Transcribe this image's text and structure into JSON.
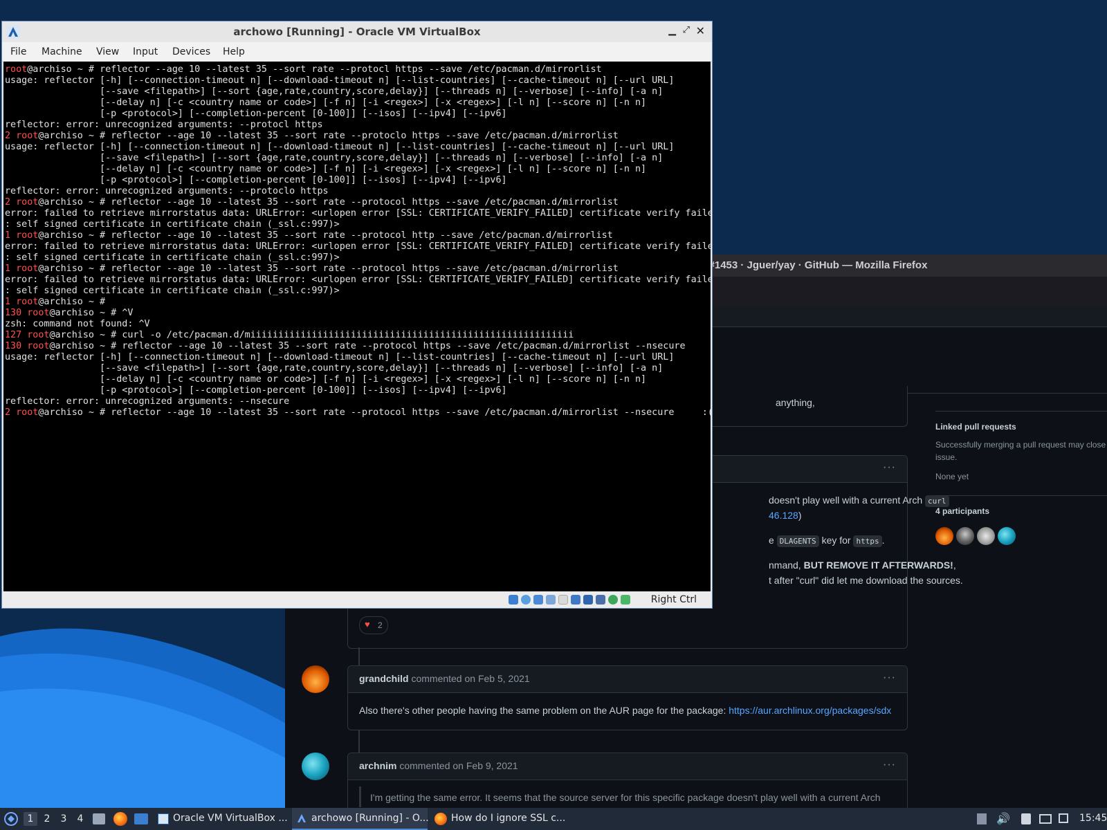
{
  "firefox": {
    "title": "e #1453 · Jguer/yay · GitHub — Mozilla Firefox",
    "comment1": {
      "partial_top": "anything,",
      "line1": "doesn't play well with a current Arch",
      "line1_code": "curl",
      "line2_link": "46.128",
      "line2_end": ")",
      "line3_pre": "e",
      "line3_code1": "DLAGENTS",
      "line3_mid": "key for",
      "line3_code2": "https",
      "line3_end": ".",
      "line4_pre": "nmand,",
      "line4_bold": "BUT REMOVE IT AFTERWARDS!",
      "line4_end": ",",
      "line5": "t after \"curl\" did let me download the sources.",
      "reaction_count": "2"
    },
    "comment2": {
      "author": "grandchild",
      "meta": "commented on Feb 5, 2021",
      "text": "Also there's other people having the same problem on the AUR page for the package:",
      "link": "https://aur.archlinux.org/packages/sdx"
    },
    "comment3": {
      "author": "archnim",
      "meta": "commented on Feb 9, 2021",
      "quote": "I'm getting the same error. It seems that the source server for this specific package doesn't play well with a current Arch"
    },
    "sidebar": {
      "linked_heading": "Linked pull requests",
      "linked_text1": "Successfully merging a pull request may close",
      "linked_text2": "issue.",
      "linked_none": "None yet",
      "participants_heading": "4 participants"
    },
    "more_label": "···"
  },
  "vbox": {
    "title": "archowo [Running] - Oracle VM VirtualBox",
    "menu": [
      "File",
      "Machine",
      "View",
      "Input",
      "Devices",
      "Help"
    ],
    "status_key": "Right Ctrl",
    "terminal_lines": [
      {
        "code": "",
        "prompt": "root@archiso ~ # ",
        "text": "reflector --age 10 --latest 35 --sort rate --protocl https --save /etc/pacman.d/mirrorlist"
      },
      {
        "code": "",
        "prompt": "",
        "text": "usage: reflector [-h] [--connection-timeout n] [--download-timeout n] [--list-countries] [--cache-timeout n] [--url URL]"
      },
      {
        "code": "",
        "prompt": "",
        "text": "                 [--save <filepath>] [--sort {age,rate,country,score,delay}] [--threads n] [--verbose] [--info] [-a n]"
      },
      {
        "code": "",
        "prompt": "",
        "text": "                 [--delay n] [-c <country name or code>] [-f n] [-i <regex>] [-x <regex>] [-l n] [--score n] [-n n]"
      },
      {
        "code": "",
        "prompt": "",
        "text": "                 [-p <protocol>] [--completion-percent [0-100]] [--isos] [--ipv4] [--ipv6]"
      },
      {
        "code": "",
        "prompt": "",
        "text": "reflector: error: unrecognized arguments: --protocl https"
      },
      {
        "code": "2 ",
        "prompt": "root@archiso ~ # ",
        "text": "reflector --age 10 --latest 35 --sort rate --protoclo https --save /etc/pacman.d/mirrorlist"
      },
      {
        "code": "",
        "prompt": "",
        "text": "usage: reflector [-h] [--connection-timeout n] [--download-timeout n] [--list-countries] [--cache-timeout n] [--url URL]"
      },
      {
        "code": "",
        "prompt": "",
        "text": "                 [--save <filepath>] [--sort {age,rate,country,score,delay}] [--threads n] [--verbose] [--info] [-a n]"
      },
      {
        "code": "",
        "prompt": "",
        "text": "                 [--delay n] [-c <country name or code>] [-f n] [-i <regex>] [-x <regex>] [-l n] [--score n] [-n n]"
      },
      {
        "code": "",
        "prompt": "",
        "text": "                 [-p <protocol>] [--completion-percent [0-100]] [--isos] [--ipv4] [--ipv6]"
      },
      {
        "code": "",
        "prompt": "",
        "text": "reflector: error: unrecognized arguments: --protoclo https"
      },
      {
        "code": "2 ",
        "prompt": "root@archiso ~ # ",
        "text": "reflector --age 10 --latest 35 --sort rate --protocol https --save /etc/pacman.d/mirrorlist"
      },
      {
        "code": "",
        "prompt": "",
        "text": "error: failed to retrieve mirrorstatus data: URLError: <urlopen error [SSL: CERTIFICATE_VERIFY_FAILED] certificate verify failed"
      },
      {
        "code": "",
        "prompt": "",
        "text": ": self signed certificate in certificate chain (_ssl.c:997)>"
      },
      {
        "code": "1 ",
        "prompt": "root@archiso ~ # ",
        "text": "reflector --age 10 --latest 35 --sort rate --protocol http --save /etc/pacman.d/mirrorlist"
      },
      {
        "code": "",
        "prompt": "",
        "text": "error: failed to retrieve mirrorstatus data: URLError: <urlopen error [SSL: CERTIFICATE_VERIFY_FAILED] certificate verify failed"
      },
      {
        "code": "",
        "prompt": "",
        "text": ": self signed certificate in certificate chain (_ssl.c:997)>"
      },
      {
        "code": "1 ",
        "prompt": "root@archiso ~ # ",
        "text": "reflector --age 10 --latest 35 --sort rate --protocol https --save /etc/pacman.d/mirrorlist"
      },
      {
        "code": "",
        "prompt": "",
        "text": "error: failed to retrieve mirrorstatus data: URLError: <urlopen error [SSL: CERTIFICATE_VERIFY_FAILED] certificate verify failed"
      },
      {
        "code": "",
        "prompt": "",
        "text": ": self signed certificate in certificate chain (_ssl.c:997)>"
      },
      {
        "code": "1 ",
        "prompt": "root@archiso ~ # ",
        "text": ""
      },
      {
        "code": "130 ",
        "prompt": "root@archiso ~ # ",
        "text": "^V"
      },
      {
        "code": "",
        "prompt": "",
        "text": "zsh: command not found: ^V"
      },
      {
        "code": "127 ",
        "prompt": "root@archiso ~ # ",
        "text": "curl -o /etc/pacman.d/miiiiiiiiiiiiiiiiiiiiiiiiiiiiiiiiiiiiiiiiiiiiiiiiiiiiiiiiii"
      },
      {
        "code": "130 ",
        "prompt": "root@archiso ~ # ",
        "text": "reflector --age 10 --latest 35 --sort rate --protocol https --save /etc/pacman.d/mirrorlist --nsecure"
      },
      {
        "code": "",
        "prompt": "",
        "text": "usage: reflector [-h] [--connection-timeout n] [--download-timeout n] [--list-countries] [--cache-timeout n] [--url URL]"
      },
      {
        "code": "",
        "prompt": "",
        "text": "                 [--save <filepath>] [--sort {age,rate,country,score,delay}] [--threads n] [--verbose] [--info] [-a n]"
      },
      {
        "code": "",
        "prompt": "",
        "text": "                 [--delay n] [-c <country name or code>] [-f n] [-i <regex>] [-x <regex>] [-l n] [--score n] [-n n]"
      },
      {
        "code": "",
        "prompt": "",
        "text": "                 [-p <protocol>] [--completion-percent [0-100]] [--isos] [--ipv4] [--ipv6]"
      },
      {
        "code": "",
        "prompt": "",
        "text": "reflector: error: unrecognized arguments: --nsecure"
      },
      {
        "code": "2 ",
        "prompt": "root@archiso ~ # ",
        "text": "reflector --age 10 --latest 35 --sort rate --protocol https --save /etc/pacman.d/mirrorlist --nsecure     :("
      }
    ]
  },
  "taskbar": {
    "workspaces": [
      "1",
      "2",
      "3",
      "4"
    ],
    "tasks": [
      "Oracle VM VirtualBox ...",
      "archowo [Running] - O...",
      "How do I ignore SSL c..."
    ],
    "clock": "15:45"
  }
}
